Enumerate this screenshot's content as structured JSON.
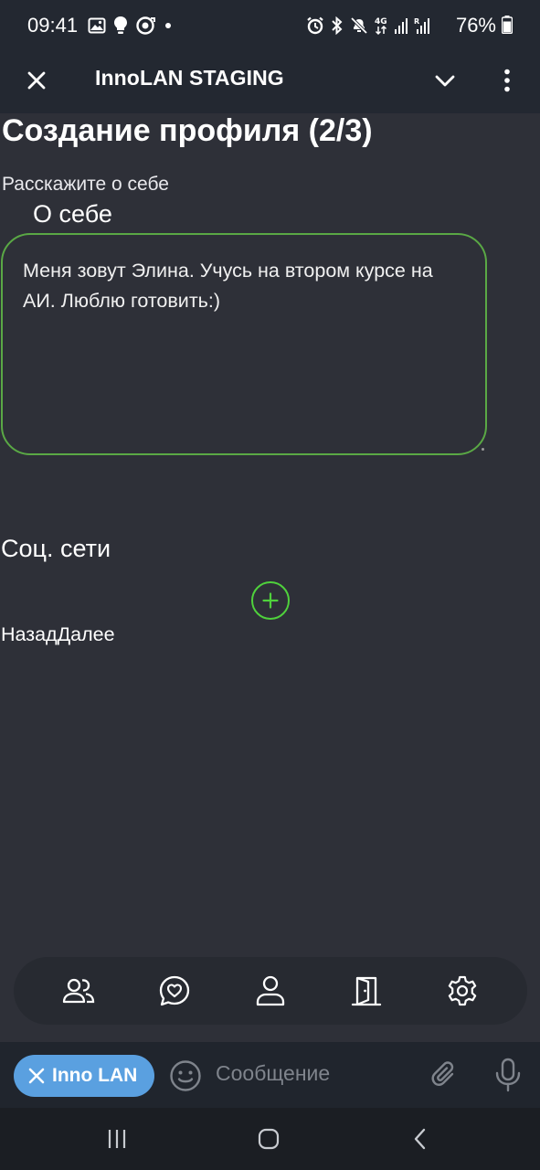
{
  "status_bar": {
    "time": "09:41",
    "battery": "76%",
    "left_icons": [
      "gallery-icon",
      "lightbulb-icon",
      "sync-icon",
      "dot-icon"
    ],
    "right_icons": [
      "alarm-icon",
      "bluetooth-icon",
      "mute-icon",
      "4g-icon",
      "signal-icon",
      "signal-r-icon"
    ]
  },
  "app_bar": {
    "title": "InnoLAN STAGING"
  },
  "form": {
    "title": "Создание профиля (2/3)",
    "about_prompt": "Расскажите о себе",
    "about_label": "О себе",
    "about_value": "Меня зовут Элина. Учусь на втором курсе на АИ. Люблю готовить:)",
    "social_label": "Соц. сети",
    "back_label": "Назад",
    "next_label": "Далее"
  },
  "bottom_nav": {
    "items": [
      "people-icon",
      "chat-heart-icon",
      "profile-icon",
      "door-icon",
      "settings-icon"
    ]
  },
  "composer": {
    "chip_label": "Inno LAN",
    "placeholder": "Сообщение"
  },
  "colors": {
    "background": "#2e3038",
    "bar": "#232831",
    "accent_green": "#5aa845",
    "plus_green": "#4fd13c",
    "chip_blue": "#5aa0e0"
  }
}
